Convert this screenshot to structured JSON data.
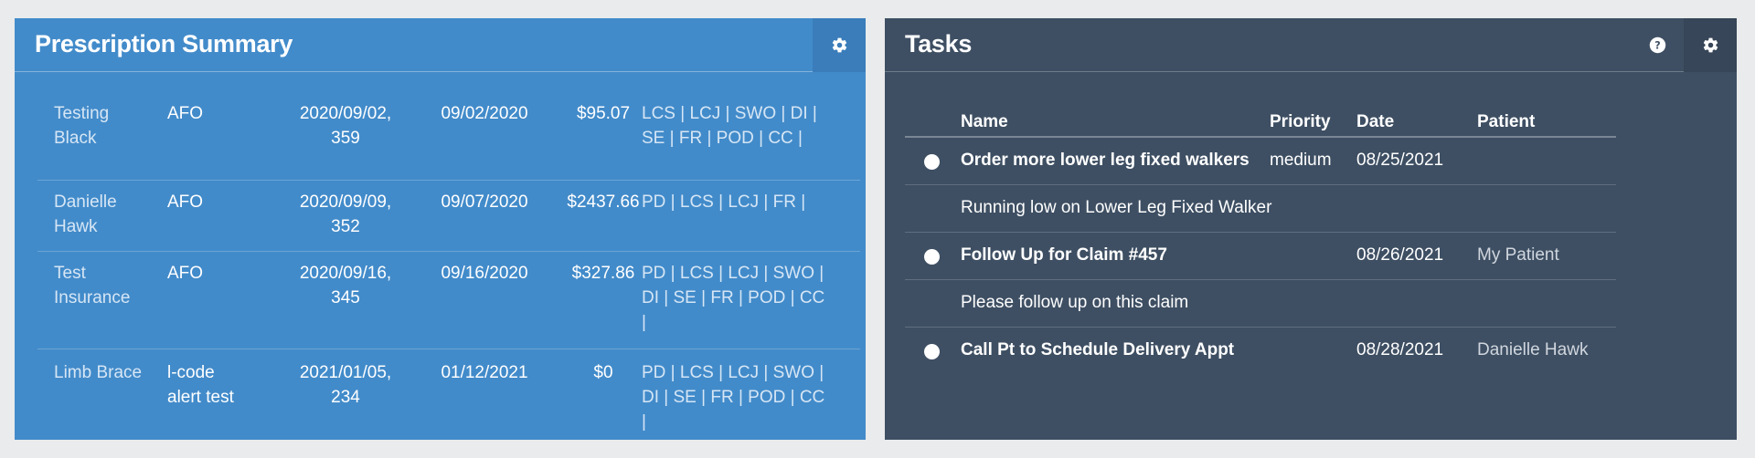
{
  "prescription_panel": {
    "title": "Prescription Summary",
    "settings_icon": "gear-icon",
    "rows": [
      {
        "name": [
          "Testing",
          "Black"
        ],
        "type": [
          "AFO"
        ],
        "date": [
          "2020/09/02,",
          "359"
        ],
        "date2": "09/02/2020",
        "amount": "$95.07",
        "codes": [
          "LCS | LCJ | SWO | DI |",
          "SE | FR | POD | CC |"
        ]
      },
      {
        "name": [
          "Danielle",
          "Hawk"
        ],
        "type": [
          "AFO"
        ],
        "date": [
          "2020/09/09,",
          "352"
        ],
        "date2": "09/07/2020",
        "amount": "$2437.66",
        "codes": [
          "PD | LCS | LCJ | FR |"
        ]
      },
      {
        "name": [
          "Test",
          "Insurance"
        ],
        "type": [
          "AFO"
        ],
        "date": [
          "2020/09/16,",
          "345"
        ],
        "date2": "09/16/2020",
        "amount": "$327.86",
        "codes": [
          "PD | LCS | LCJ | SWO |",
          "DI | SE | FR | POD | CC",
          "|"
        ]
      },
      {
        "name": [
          "Limb Brace"
        ],
        "type": [
          "l-code",
          "alert test"
        ],
        "date": [
          "2021/01/05,",
          "234"
        ],
        "date2": "01/12/2021",
        "amount": "$0",
        "codes": [
          "PD | LCS | LCJ | SWO |",
          "DI | SE | FR | POD | CC",
          "|"
        ]
      }
    ]
  },
  "tasks_panel": {
    "title": "Tasks",
    "help_icon": "question-circle-icon",
    "settings_icon": "gear-icon",
    "columns": {
      "name": "Name",
      "priority": "Priority",
      "date": "Date",
      "patient": "Patient"
    },
    "tasks": [
      {
        "name": "Order more lower leg fixed walkers",
        "priority": "medium",
        "date": "08/25/2021",
        "patient": "",
        "note": "Running low on Lower Leg Fixed Walker"
      },
      {
        "name": "Follow Up for Claim #457",
        "priority": "",
        "date": "08/26/2021",
        "patient": "My Patient",
        "note": "Please follow up on this claim"
      },
      {
        "name": "Call Pt to Schedule Delivery Appt",
        "priority": "",
        "date": "08/28/2021",
        "patient": "Danielle Hawk",
        "note": ""
      }
    ]
  }
}
